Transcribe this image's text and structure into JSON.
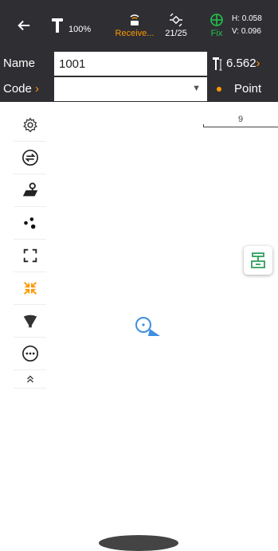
{
  "status_bar": {
    "battery": "100%",
    "receive": "Receive...",
    "satellites": "21/25",
    "fix": "Fix",
    "h_precision": "H: 0.058",
    "v_precision": "V: 0.096"
  },
  "form": {
    "name_label": "Name",
    "name_value": "1001",
    "antenna_height": "6.562",
    "code_label": "Code",
    "point_type": "Point"
  },
  "map": {
    "scale_value": "9"
  },
  "colors": {
    "bar_bg": "#2f2f33",
    "accent_orange": "#ff9800",
    "fix_green": "#22c34a",
    "station_green": "#2e9e5b",
    "cursor_blue": "#3d8fe0"
  },
  "icons": {
    "tools": [
      "settings-icon",
      "swap-icon",
      "map-layer-icon",
      "points-icon",
      "fullscreen-icon",
      "collapse-arrows-icon",
      "signal-beam-icon",
      "more-icon",
      "double-chevron-up-icon"
    ]
  }
}
